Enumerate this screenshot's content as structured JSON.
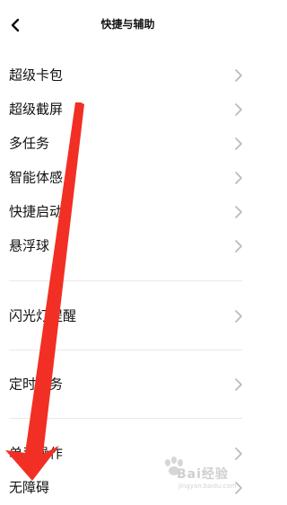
{
  "header": {
    "title": "快捷与辅助",
    "back_icon": "chevron-left-icon"
  },
  "groups": [
    {
      "items": [
        {
          "label": "超级卡包"
        },
        {
          "label": "超级截屏"
        },
        {
          "label": "多任务"
        },
        {
          "label": "智能体感"
        },
        {
          "label": "快捷启动"
        },
        {
          "label": "悬浮球"
        }
      ]
    },
    {
      "items": [
        {
          "label": "闪光灯提醒"
        }
      ]
    },
    {
      "items": [
        {
          "label": "定时任务"
        }
      ]
    },
    {
      "items": [
        {
          "label": "单手操作"
        },
        {
          "label": "无障碍"
        }
      ]
    }
  ],
  "annotation": {
    "color": "#f22f24"
  },
  "watermark": {
    "brand": "Bai经验",
    "url": "jingyan.baidu.com"
  }
}
